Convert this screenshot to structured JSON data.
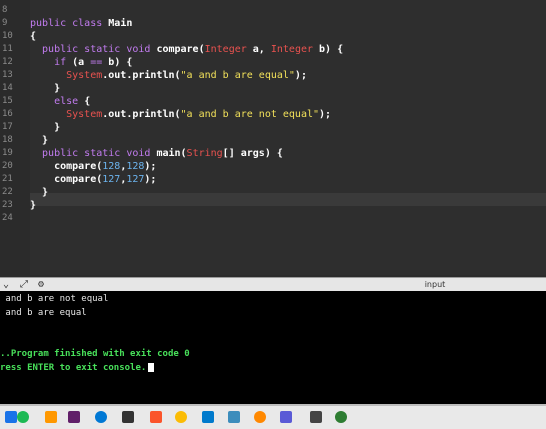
{
  "editor": {
    "line_numbers": [
      "8",
      "9",
      "10",
      "11",
      "12",
      "13",
      "14",
      "15",
      "16",
      "17",
      "18",
      "19",
      "20",
      "21",
      "22",
      "23",
      "24"
    ],
    "lines": [
      [],
      [
        {
          "t": "public class ",
          "c": "kp"
        },
        {
          "t": "Main",
          "c": "pl"
        }
      ],
      [
        {
          "t": "{",
          "c": "pl"
        }
      ],
      [
        {
          "t": "  public static void ",
          "c": "kp"
        },
        {
          "t": "compare(",
          "c": "pl"
        },
        {
          "t": "Integer",
          "c": "ty"
        },
        {
          "t": " a, ",
          "c": "pl"
        },
        {
          "t": "Integer",
          "c": "ty"
        },
        {
          "t": " b) {",
          "c": "pl"
        }
      ],
      [
        {
          "t": "    ",
          "c": "pl"
        },
        {
          "t": "if",
          "c": "kp"
        },
        {
          "t": " (a ",
          "c": "pl"
        },
        {
          "t": "==",
          "c": "kp"
        },
        {
          "t": " b) {",
          "c": "pl"
        }
      ],
      [
        {
          "t": "      ",
          "c": "pl"
        },
        {
          "t": "System",
          "c": "ty"
        },
        {
          "t": ".out.println(",
          "c": "pl"
        },
        {
          "t": "\"a and b are equal\"",
          "c": "st"
        },
        {
          "t": ");",
          "c": "pl"
        }
      ],
      [
        {
          "t": "    }",
          "c": "pl"
        }
      ],
      [
        {
          "t": "    ",
          "c": "pl"
        },
        {
          "t": "else",
          "c": "kp"
        },
        {
          "t": " {",
          "c": "pl"
        }
      ],
      [
        {
          "t": "      ",
          "c": "pl"
        },
        {
          "t": "System",
          "c": "ty"
        },
        {
          "t": ".out.println(",
          "c": "pl"
        },
        {
          "t": "\"a and b are not equal\"",
          "c": "st"
        },
        {
          "t": ");",
          "c": "pl"
        }
      ],
      [
        {
          "t": "    }",
          "c": "pl"
        }
      ],
      [
        {
          "t": "  }",
          "c": "pl"
        }
      ],
      [
        {
          "t": "  public static void ",
          "c": "kp"
        },
        {
          "t": "main(",
          "c": "pl"
        },
        {
          "t": "String",
          "c": "ty"
        },
        {
          "t": "[] args) {",
          "c": "pl"
        }
      ],
      [
        {
          "t": "    compare(",
          "c": "pl"
        },
        {
          "t": "128",
          "c": "nu"
        },
        {
          "t": ",",
          "c": "pl"
        },
        {
          "t": "128",
          "c": "nu"
        },
        {
          "t": ");",
          "c": "pl"
        }
      ],
      [
        {
          "t": "    compare(",
          "c": "pl"
        },
        {
          "t": "127",
          "c": "nu"
        },
        {
          "t": ",",
          "c": "pl"
        },
        {
          "t": "127",
          "c": "nu"
        },
        {
          "t": ");",
          "c": "pl"
        }
      ],
      [
        {
          "t": "  }",
          "c": "pl"
        }
      ],
      [
        {
          "t": "}",
          "c": "pl"
        }
      ],
      []
    ]
  },
  "toolbar": {
    "input_tab": "input"
  },
  "console": {
    "lines": [
      " and b are not equal",
      " and b are equal",
      "",
      "",
      "..Program finished with exit code 0",
      "ress ENTER to exit console."
    ]
  },
  "taskbar": {
    "icons": [
      {
        "name": "task-view-icon",
        "color": "#1a73e8"
      },
      {
        "name": "spotify-icon",
        "color": "#1db954"
      },
      {
        "name": "sublime-icon",
        "color": "#ff9800"
      },
      {
        "name": "slack-icon",
        "color": "#611f69"
      },
      {
        "name": "outlook-icon",
        "color": "#0078d4"
      },
      {
        "name": "obs-icon",
        "color": "#333333"
      },
      {
        "name": "brave-icon",
        "color": "#fb542b"
      },
      {
        "name": "chrome-icon",
        "color": "#fbbc05"
      },
      {
        "name": "vscode-icon",
        "color": "#007acc"
      },
      {
        "name": "git-icon",
        "color": "#3c8dbc"
      },
      {
        "name": "vlc-icon",
        "color": "#ff8800"
      },
      {
        "name": "camera-icon",
        "color": "#5a5ad6"
      },
      {
        "name": "settings-icon",
        "color": "#444444"
      },
      {
        "name": "terminal-icon",
        "color": "#2e7d32"
      }
    ]
  }
}
